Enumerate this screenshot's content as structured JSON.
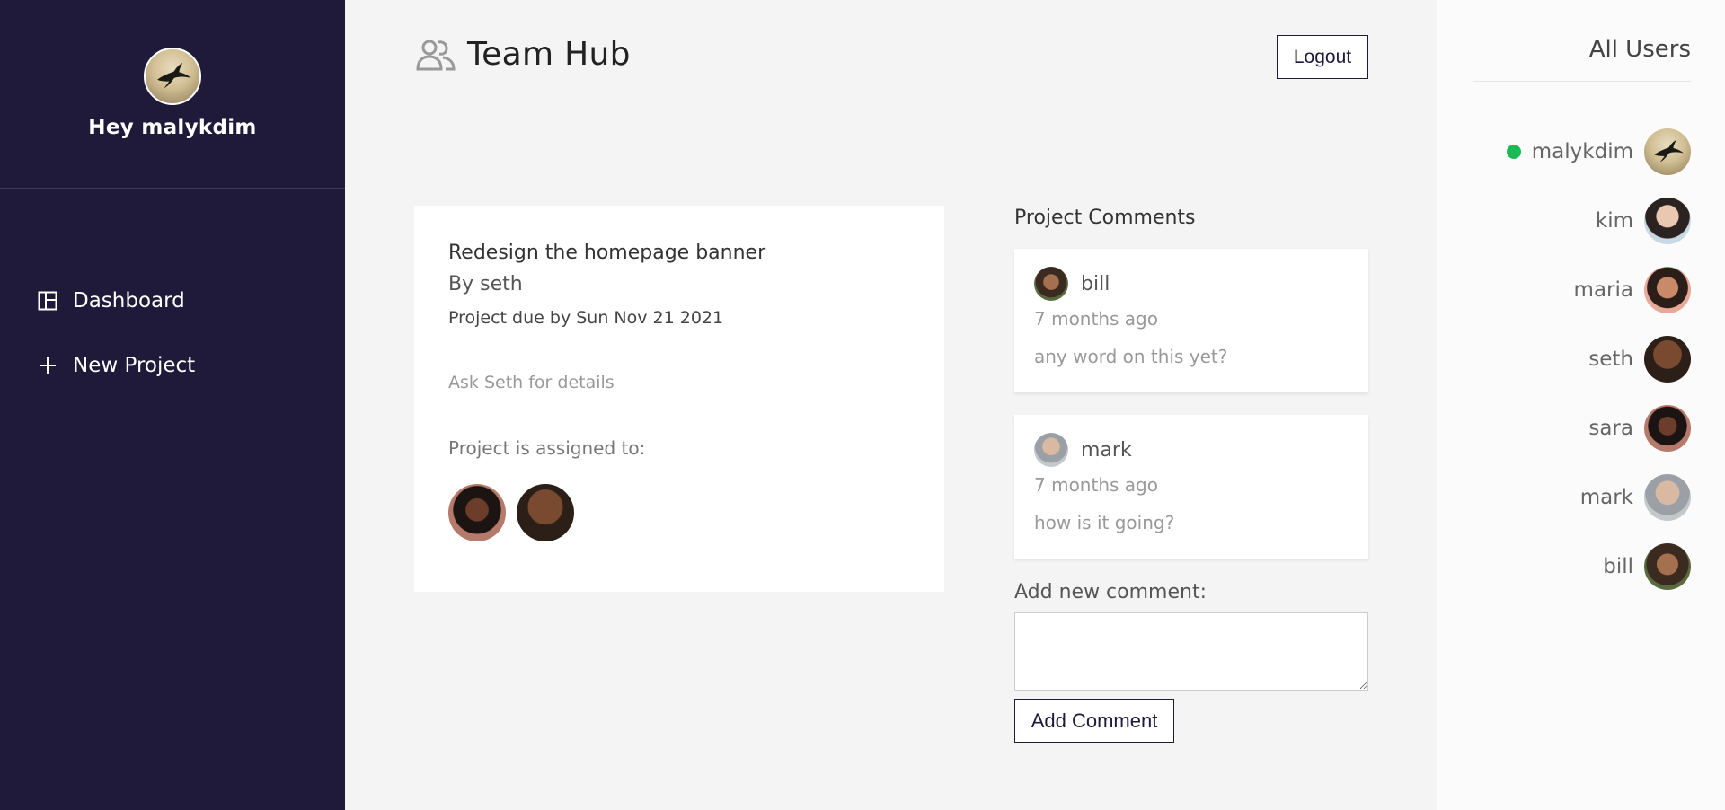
{
  "sidebar": {
    "greeting": "Hey malykdim",
    "nav": [
      {
        "label": "Dashboard",
        "icon": "dashboard-icon"
      },
      {
        "label": "New Project",
        "icon": "plus-icon"
      }
    ]
  },
  "header": {
    "title": "Team Hub",
    "logout_label": "Logout"
  },
  "project": {
    "title": "Redesign the homepage banner",
    "by": "By seth",
    "due": "Project due by Sun Nov 21 2021",
    "details": "Ask Seth for details",
    "assigned_label": "Project is assigned to:",
    "assignees": [
      "sara",
      "seth"
    ]
  },
  "comments": {
    "heading": "Project Comments",
    "items": [
      {
        "author": "bill",
        "date": "7 months ago",
        "text": "any word on this yet?"
      },
      {
        "author": "mark",
        "date": "7 months ago",
        "text": "how is it going?"
      }
    ],
    "add_label": "Add new comment:",
    "textarea_value": "",
    "submit_label": "Add Comment"
  },
  "users": {
    "heading": "All Users",
    "online_color": "#1db954",
    "list": [
      {
        "name": "malykdim",
        "online": true
      },
      {
        "name": "kim",
        "online": false
      },
      {
        "name": "maria",
        "online": false
      },
      {
        "name": "seth",
        "online": false
      },
      {
        "name": "sara",
        "online": false
      },
      {
        "name": "mark",
        "online": false
      },
      {
        "name": "bill",
        "online": false
      }
    ]
  },
  "colors": {
    "sidebar_bg": "#201a3a",
    "main_bg": "#f4f4f4",
    "accent": "#201a3a"
  }
}
